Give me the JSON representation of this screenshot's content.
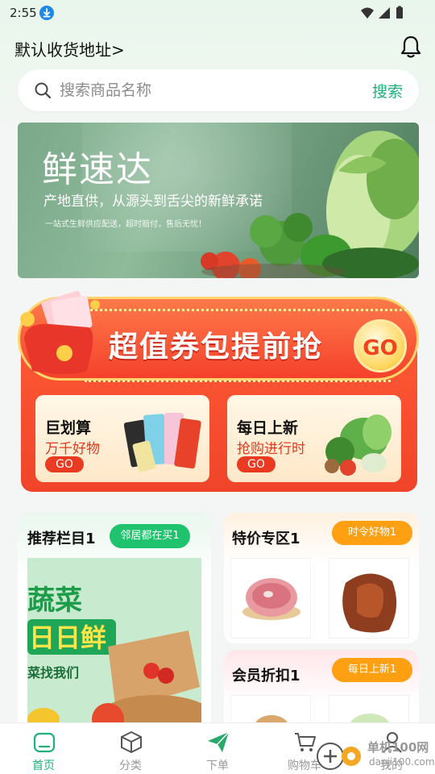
{
  "status_bar": {
    "time": "2:55"
  },
  "header": {
    "address_label": "默认收货地址",
    "address_chevron": ">"
  },
  "search": {
    "placeholder": "搜索商品名称",
    "button": "搜索"
  },
  "hero": {
    "title": "鲜速达",
    "subtitle": "产地直供，从源头到舌尖的新鲜承诺",
    "small": "一站式生鲜供应配送，超时赔付，售后无忧！"
  },
  "coupon": {
    "title": "超值券包提前抢",
    "go": "GO",
    "cards": [
      {
        "title": "巨划算",
        "desc": "万千好物",
        "go": "GO"
      },
      {
        "title": "每日上新",
        "desc": "抢购进行时",
        "go": "GO"
      }
    ]
  },
  "recommend": {
    "title": "推荐栏目1",
    "tag": "邻居都在买1",
    "image_text_1": "蔬菜",
    "image_text_2": "日日鲜",
    "image_text_3": "菜找我们"
  },
  "special": {
    "title": "特价专区1",
    "tag": "时令好物1"
  },
  "member": {
    "title": "会员折扣1",
    "tag": "每日上新1"
  },
  "nav": {
    "items": [
      {
        "label": "首页",
        "icon": "home-icon",
        "active": true
      },
      {
        "label": "分类",
        "icon": "cube-icon",
        "active": false
      },
      {
        "label": "下单",
        "icon": "paper-plane-icon",
        "active": false
      },
      {
        "label": "购物车",
        "icon": "cart-icon",
        "active": false
      },
      {
        "label": "我的",
        "icon": "user-icon",
        "active": false
      }
    ]
  },
  "watermark": {
    "line1": "单机100网",
    "line2": "danji100.com"
  },
  "colors": {
    "accent": "#20b07a",
    "coupon_red": "#f0442a",
    "tag_orange": "#ff9f12",
    "tag_green": "#1fc36e"
  }
}
